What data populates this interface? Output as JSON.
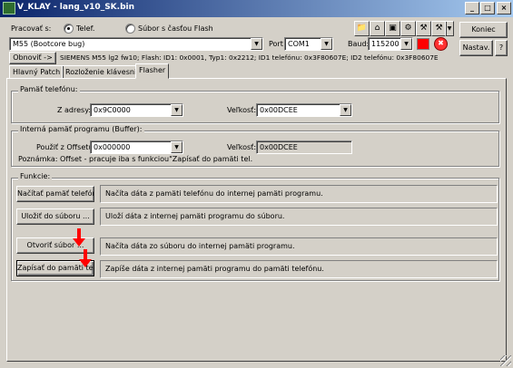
{
  "window": {
    "title": "V_KLAY - lang_v10_SK.bin",
    "minimize": "_",
    "maximize": "□",
    "close": "×"
  },
  "mode": {
    "label": "Pracovať s:",
    "option1": "Telef.",
    "option2": "Súbor s časťou Flash",
    "selected": "Telef."
  },
  "phone_combo": {
    "value": "M55 (Bootcore bug)"
  },
  "port": {
    "label": "Port",
    "value": "COM1"
  },
  "baud": {
    "label": "Baud:",
    "value": "115200"
  },
  "refresh_button": "Obnoviť ->",
  "phone_info": "SIEMENS M55 lg2 fw10; Flash: ID1: 0x0001, Typ1: 0x2212; ID1 telefónu: 0x3F80607E; ID2 telefónu: 0x3F80607E",
  "right_buttons": {
    "close": "Koniec",
    "settings": "Nastav.",
    "help": "?"
  },
  "toolbar": {
    "icons": [
      "folder-icon",
      "house-icon",
      "id-card-icon",
      "settings-icon",
      "tools-icon",
      "tools2-icon",
      "dropdown-arrow-icon"
    ]
  },
  "status_colors": {
    "indicator": "#ff0000",
    "stop": "#ff0000",
    "arrow": "#ff0000"
  },
  "tabs": [
    {
      "label": "Hlavný Patch",
      "active": false
    },
    {
      "label": "Rozloženie klávesnice",
      "active": false
    },
    {
      "label": "Flasher",
      "active": true
    }
  ],
  "phone_memory": {
    "title": "Pamäť telefónu:",
    "address_label": "Z adresy:",
    "address_value": "0x9C0000",
    "size_label": "Veľkosť:",
    "size_value": "0x00DCEE"
  },
  "buffer": {
    "title": "Interná pamäť programu (Buffer):",
    "offset_label": "Použiť z Offsetu:",
    "offset_value": "0x000000",
    "size_label": "Veľkosť:",
    "size_value": "0x00DCEE",
    "note": "Poznámka: Offset - pracuje iba s funkciou\"Zapísať do pamäti tel."
  },
  "functions": {
    "title": "Funkcie:",
    "items": [
      {
        "button": "Načítať pamäť telefónu",
        "description": "Načíta dáta z pamäti telefónu do internej pamäti programu."
      },
      {
        "button": "Uložiť do súboru ...",
        "description": "Uloží dáta z internej pamäti programu do súboru."
      },
      {
        "button": "Otvoriť súbor ...",
        "description": "Načíta dáta zo súboru do internej pamäti programu."
      },
      {
        "button": "Zapísať do pamäti tel.",
        "description": "Zapíše dáta z internej pamäti programu do pamäti telefónu."
      }
    ]
  }
}
